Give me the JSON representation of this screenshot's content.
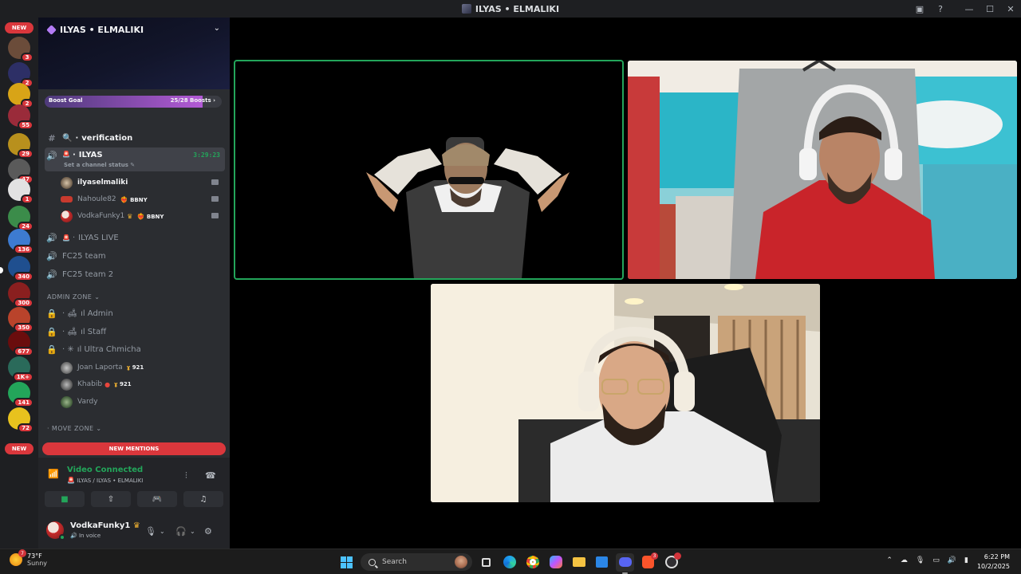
{
  "window": {
    "title": "ILYAS • ELMALIKI"
  },
  "rail": {
    "top_pill": "NEW",
    "bottom_pill": "NEW",
    "servers": [
      {
        "badge": "3",
        "color": "#6b4c3a"
      },
      {
        "badge": "2",
        "color": "#2d2f66"
      },
      {
        "badge": "2",
        "color": "#d8a417"
      },
      {
        "badge": "55",
        "color": "#9a2b3a"
      },
      {
        "badge": "29",
        "color": "#b8901d"
      },
      {
        "badge": "47",
        "color": "#5a5a5a"
      },
      {
        "badge": "1",
        "color": "#e2e2e2"
      },
      {
        "badge": "24",
        "color": "#3b8c4a"
      },
      {
        "badge": "136",
        "color": "#3d7bd1"
      },
      {
        "badge": "340",
        "color": "#1f4f8f"
      },
      {
        "badge": "300",
        "color": "#8a1f1f"
      },
      {
        "badge": "350",
        "color": "#b9432b"
      },
      {
        "badge": "677",
        "color": "#6a0d0d"
      },
      {
        "badge": "1K+",
        "color": "#2a6a5a"
      },
      {
        "badge": "141",
        "color": "#23a55a"
      },
      {
        "badge": "72",
        "color": "#e8c21e"
      }
    ]
  },
  "server": {
    "name": "ILYAS • ELMALIKI",
    "boost": {
      "label": "Boost Goal",
      "count": "25/28 Boosts",
      "progress": 0.893
    }
  },
  "channels": {
    "verification": "verification",
    "active_voice": {
      "name": "ILYAS",
      "timer": "3:29:23",
      "status_hint": "Set a channel status"
    },
    "members": [
      {
        "name": "ilyaselmaliki",
        "tag": "",
        "self": true
      },
      {
        "name": "Nahoule82",
        "tag": "BBNY",
        "self": false
      },
      {
        "name": "VodkaFunky1",
        "tag": "BBNY",
        "self": false
      }
    ],
    "ilyas_live": "ILYAS LIVE",
    "fc25_team": "FC25 team",
    "fc25_team_2": "FC25 team 2",
    "admin_zone": "ADMIN ZONE",
    "admin": "ıl Admin",
    "staff": "ıl Staff",
    "ultra": "ıl Ultra Chmicha",
    "admin_members": [
      {
        "name": "Joan Laporta",
        "tag": "921"
      },
      {
        "name": "Khabib",
        "tag": "921"
      },
      {
        "name": "Vardy",
        "tag": ""
      }
    ],
    "move_zone": "MOVE ZONE",
    "new_mentions": "NEW MENTIONS"
  },
  "voice_panel": {
    "status": "Video Connected",
    "location": "ILYAS / ILYAS • ELMALIKI"
  },
  "user": {
    "name": "VodkaFunky1",
    "status": "In voice"
  },
  "taskbar": {
    "weather_temp": "73°F",
    "weather_desc": "Sunny",
    "weather_badge": "7",
    "search_placeholder": "Search",
    "time": "6:22 PM",
    "date": "10/2/2025",
    "brave_badge": "3"
  },
  "colors": {
    "accent_green": "#23a55a",
    "alert_red": "#da373c",
    "boost_purple": "#b35ad6"
  }
}
